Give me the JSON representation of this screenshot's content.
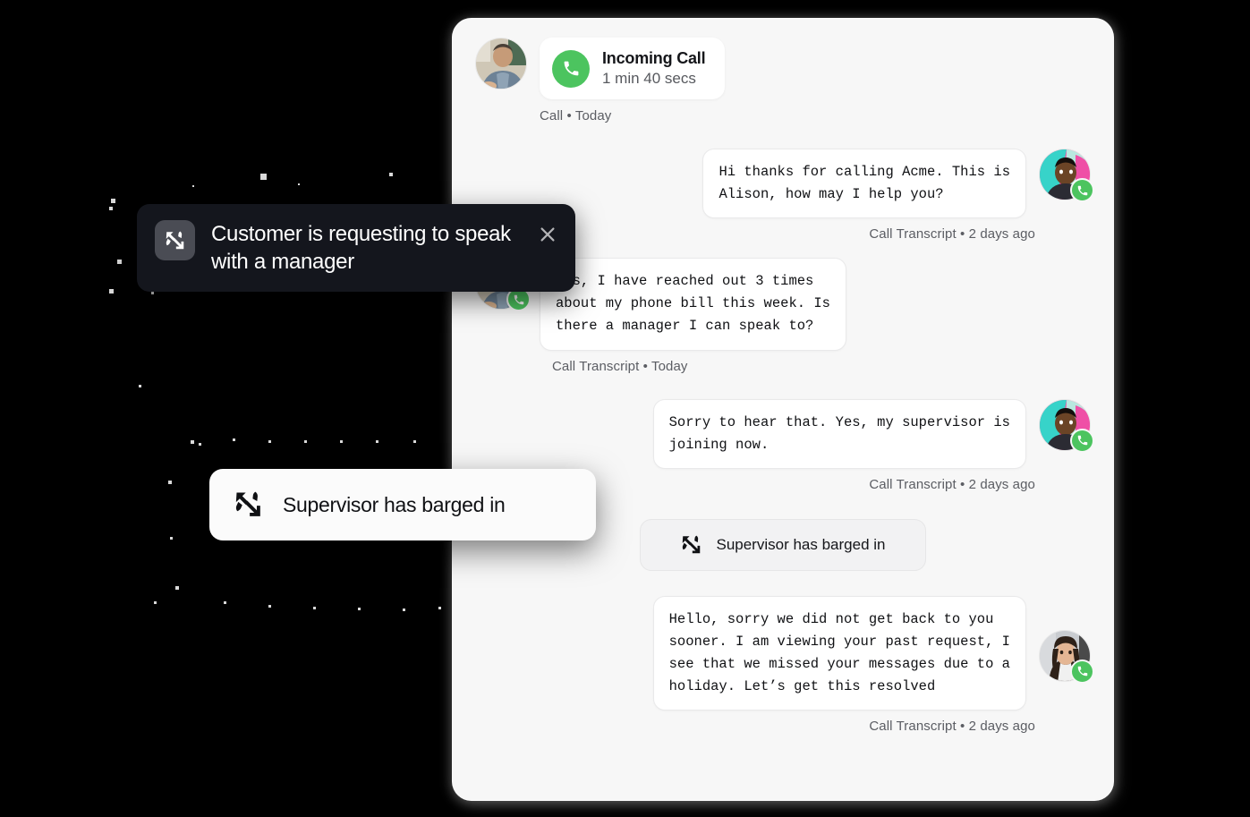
{
  "theme": {
    "page_background": "#000000",
    "panel_background": "#f7f7f7",
    "bubble_background": "#ffffff",
    "accent_green": "#4cc45f",
    "toast_dark_background": "#14161d",
    "toast_light_background": "#fbfbfb",
    "text_primary": "#101114",
    "text_muted": "#5b5d63"
  },
  "call_header": {
    "title": "Incoming Call",
    "duration": "1 min 40 secs",
    "meta": "Call • Today",
    "phone_icon": "phone-icon",
    "avatar_name": "customer-avatar"
  },
  "messages": [
    {
      "id": "msg-agent-greeting",
      "side": "right",
      "speaker": "agent",
      "text": "Hi thanks for calling Acme. This is\nAlison, how may I help you?",
      "meta": "Call Transcript • 2 days ago",
      "avatar": "agent-avatar",
      "badge": "phone-icon"
    },
    {
      "id": "msg-customer-request",
      "side": "left",
      "speaker": "customer",
      "text": "Yes, I have reached out 3 times\nabout my phone bill this week. Is\nthere a manager I can speak to?",
      "meta": "Call Transcript • Today",
      "avatar": "customer-avatar",
      "badge": "phone-icon"
    },
    {
      "id": "msg-agent-supervisor",
      "side": "right",
      "speaker": "agent",
      "text": "Sorry to hear that. Yes, my supervisor is\njoining now.",
      "meta": "Call Transcript • 2 days ago",
      "avatar": "agent-avatar",
      "badge": "phone-icon"
    },
    {
      "id": "msg-supervisor-reply",
      "side": "right",
      "speaker": "supervisor",
      "text": "Hello, sorry we did not get back to you\nsooner. I am viewing your past request, I\nsee that we missed your messages due to a\nholiday. Let’s get this resolved",
      "meta": "Call Transcript • 2 days ago",
      "avatar": "supervisor-avatar",
      "badge": "phone-icon"
    }
  ],
  "system_event": {
    "label": "Supervisor has barged in",
    "icon": "phone-barge-in-icon"
  },
  "toasts": [
    {
      "id": "toast-manager-request",
      "style": "dark",
      "message": "Customer is requesting to speak with a manager",
      "icon": "phone-barge-in-icon",
      "close_label": "close-icon",
      "has_close": true
    },
    {
      "id": "toast-supervisor-barged",
      "style": "light",
      "message": "Supervisor has barged in",
      "icon": "phone-barge-in-icon",
      "has_close": false
    }
  ]
}
